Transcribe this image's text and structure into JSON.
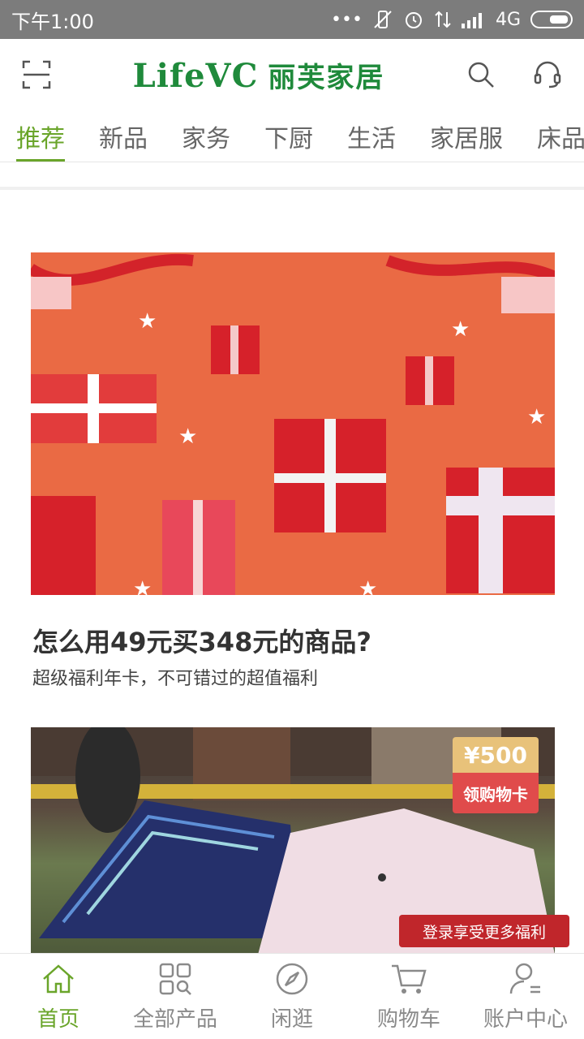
{
  "status_bar": {
    "time": "下午1:00",
    "signal_text": "4G"
  },
  "header": {
    "logo_en": "LifeVC",
    "logo_cn": "丽芙家居"
  },
  "tabs": [
    {
      "label": "推荐"
    },
    {
      "label": "新品"
    },
    {
      "label": "家务"
    },
    {
      "label": "下厨"
    },
    {
      "label": "生活"
    },
    {
      "label": "家居服"
    },
    {
      "label": "床品"
    }
  ],
  "article": {
    "title": "怎么用49元买348元的商品?",
    "subtitle": "超级福利年卡，不可错过的超值福利"
  },
  "coupon": {
    "amount": "¥500",
    "label": "领购物卡"
  },
  "login_tip": "登录享受更多福利",
  "bottom_nav": [
    {
      "label": "首页",
      "icon": "home-icon"
    },
    {
      "label": "全部产品",
      "icon": "grid-search-icon"
    },
    {
      "label": "闲逛",
      "icon": "compass-icon"
    },
    {
      "label": "购物车",
      "icon": "cart-icon"
    },
    {
      "label": "账户中心",
      "icon": "user-icon"
    }
  ],
  "colors": {
    "accent": "#6aa52a",
    "logo": "#1f8a3b",
    "banner_bg": "#ea6a44",
    "tip_bg": "#c0262b"
  }
}
